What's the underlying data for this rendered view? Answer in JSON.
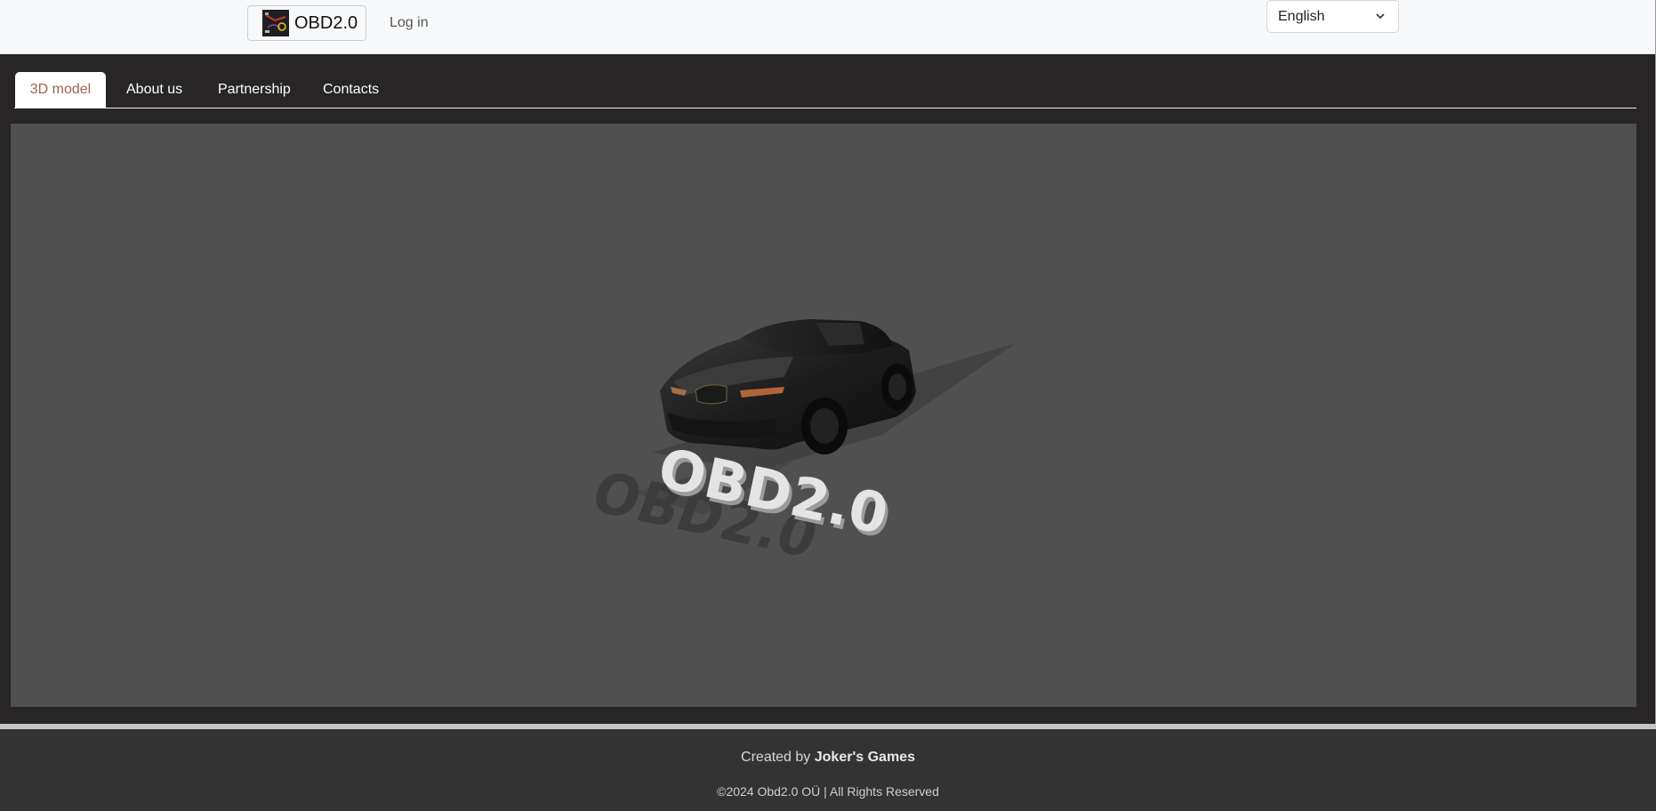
{
  "header": {
    "brand_name": "OBD2.0",
    "login_label": "Log in",
    "language": {
      "selected": "English"
    }
  },
  "tabs": [
    {
      "label": "3D model",
      "active": true
    },
    {
      "label": "About us",
      "active": false
    },
    {
      "label": "Partnership",
      "active": false
    },
    {
      "label": "Contacts",
      "active": false
    }
  ],
  "viewer": {
    "model_text": "OBD2.0",
    "background_color": "#505050"
  },
  "footer": {
    "created_prefix": "Created by",
    "created_by": "Joker's Games",
    "copyright": "©2024 Obd2.0 OÜ | All Rights Reserved"
  },
  "colors": {
    "active_tab_text": "#a0634e",
    "page_background": "#272526",
    "footer_background": "#333333"
  }
}
